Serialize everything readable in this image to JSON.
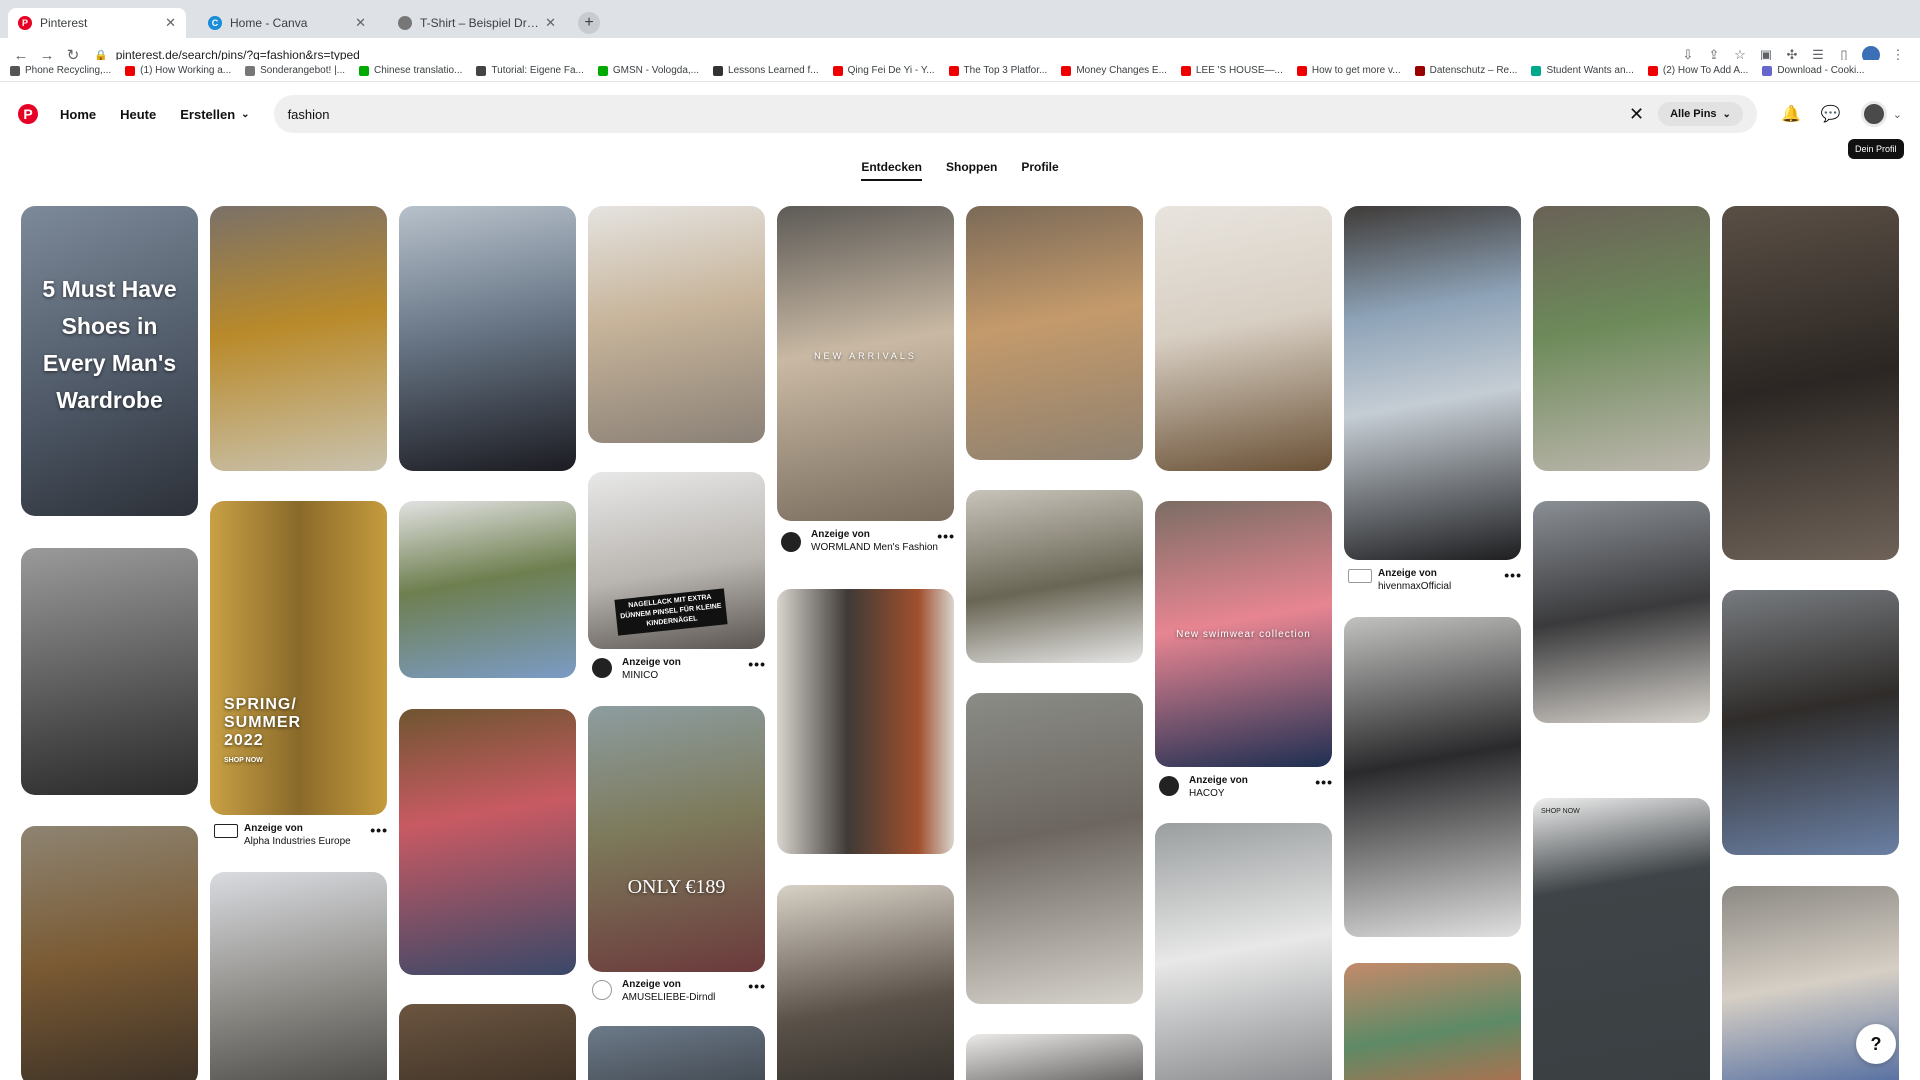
{
  "browser": {
    "tabs": [
      {
        "title": "Pinterest",
        "active": true,
        "favicon_color": "#e60023"
      },
      {
        "title": "Home - Canva",
        "active": false,
        "favicon_color": "#1a8cd8"
      },
      {
        "title": "T-Shirt – Beispiel Dropshipping",
        "active": false,
        "favicon_color": "#777777"
      }
    ],
    "new_tab": "+",
    "url": "pinterest.de/search/pins/?q=fashion&rs=typed",
    "bookmarks": [
      "Phone Recycling,...",
      "(1) How Working a...",
      "Sonderangebot! |...",
      "Chinese translatio...",
      "Tutorial: Eigene Fa...",
      "GMSN - Vologda,...",
      "Lessons Learned f...",
      "Qing Fei De Yi - Y...",
      "The Top 3 Platfor...",
      "Money Changes E...",
      "LEE 'S HOUSE—...",
      "How to get more v...",
      "Datenschutz – Re...",
      "Student Wants an...",
      "(2) How To Add A...",
      "Download - Cooki..."
    ]
  },
  "header": {
    "logo": "P",
    "nav": [
      "Home",
      "Heute",
      "Erstellen"
    ],
    "search_value": "fashion",
    "filter": "Alle Pins",
    "tooltip": "Dein Profil"
  },
  "subtabs": [
    "Entdecken",
    "Shoppen",
    "Profile"
  ],
  "pins": {
    "p1_text": "5 Must Have Shoes in Every Man's Wardrobe",
    "p2_text": "SPRING/ SUMMER 2022",
    "p2_sub": "SHOP NOW",
    "p3_text": "NAGELLACK MIT EXTRA DÜNNEM PINSEL FÜR KLEINE KINDERNÄGEL",
    "p4_text": "NEW ARRIVALS",
    "p5_text": "ONLY €189",
    "p6_text": "New swimwear collection",
    "p7_text": "SHOP NOW"
  },
  "ads": [
    {
      "label": "Anzeige von",
      "name": "Alpha Industries Europe"
    },
    {
      "label": "Anzeige von",
      "name": "MINICO"
    },
    {
      "label": "Anzeige von",
      "name": "AMUSELIEBE-Dirndl"
    },
    {
      "label": "Anzeige von",
      "name": "WORMLAND Men's Fashion"
    },
    {
      "label": "Anzeige von",
      "name": "HACOY"
    },
    {
      "label": "Anzeige von",
      "name": "hivenmaxOfficial"
    }
  ],
  "more_glyph": "•••",
  "help": "?"
}
